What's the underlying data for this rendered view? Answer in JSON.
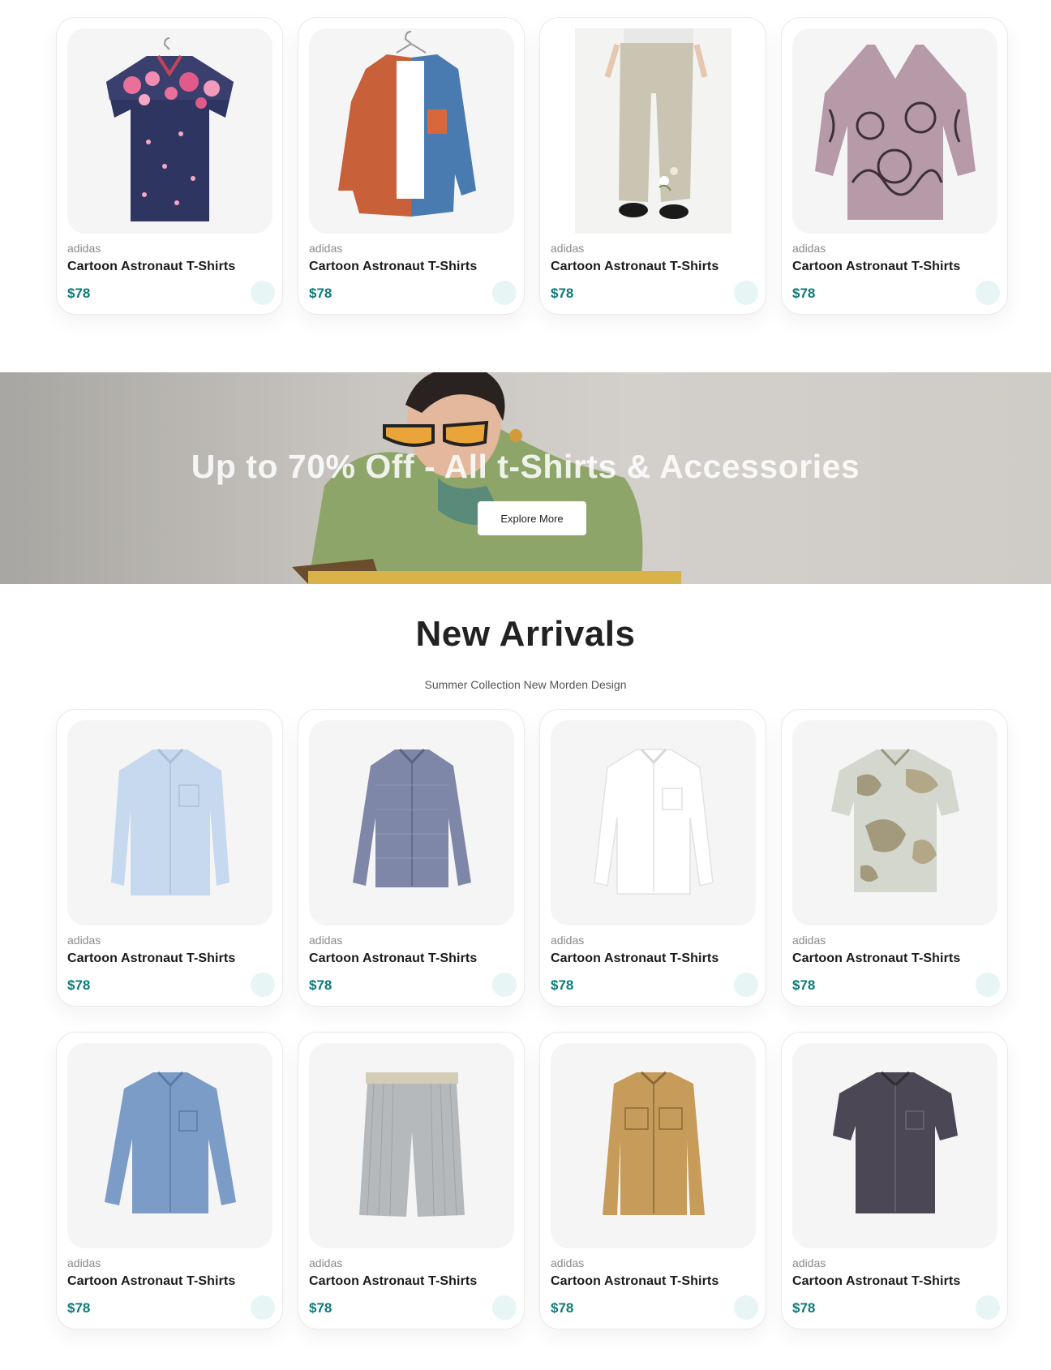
{
  "products_top": [
    {
      "brand": "adidas",
      "name": "Cartoon Astronaut T-Shirts",
      "price": "$78",
      "image": "floral-navy-shirt"
    },
    {
      "brand": "adidas",
      "name": "Cartoon Astronaut T-Shirts",
      "price": "$78",
      "image": "orange-blue-colorblock-shirt"
    },
    {
      "brand": "adidas",
      "name": "Cartoon Astronaut T-Shirts",
      "price": "$78",
      "image": "linen-trousers"
    },
    {
      "brand": "adidas",
      "name": "Cartoon Astronaut T-Shirts",
      "price": "$78",
      "image": "mauve-cat-print-blouse"
    }
  ],
  "banner": {
    "title": "Up to 70% Off - All t-Shirts & Accessories",
    "button_label": "Explore More"
  },
  "new_arrivals": {
    "title": "New Arrivals",
    "subtitle": "Summer Collection New Morden Design",
    "row1": [
      {
        "brand": "adidas",
        "name": "Cartoon Astronaut T-Shirts",
        "price": "$78",
        "image": "light-blue-shirt"
      },
      {
        "brand": "adidas",
        "name": "Cartoon Astronaut T-Shirts",
        "price": "$78",
        "image": "gingham-shirt"
      },
      {
        "brand": "adidas",
        "name": "Cartoon Astronaut T-Shirts",
        "price": "$78",
        "image": "white-shirt"
      },
      {
        "brand": "adidas",
        "name": "Cartoon Astronaut T-Shirts",
        "price": "$78",
        "image": "camo-print-shirt"
      }
    ],
    "row2": [
      {
        "brand": "adidas",
        "name": "Cartoon Astronaut T-Shirts",
        "price": "$78",
        "image": "denim-shirt"
      },
      {
        "brand": "adidas",
        "name": "Cartoon Astronaut T-Shirts",
        "price": "$78",
        "image": "striped-shorts"
      },
      {
        "brand": "adidas",
        "name": "Cartoon Astronaut T-Shirts",
        "price": "$78",
        "image": "tan-overshirt"
      },
      {
        "brand": "adidas",
        "name": "Cartoon Astronaut T-Shirts",
        "price": "$78",
        "image": "charcoal-short-sleeve-shirt"
      }
    ]
  },
  "colors": {
    "price": "#0b7a77",
    "cart_button_bg": "#e7f6f5",
    "card_image_bg": "#f5f5f5"
  },
  "icons": {
    "cart_button": "cart-icon"
  }
}
